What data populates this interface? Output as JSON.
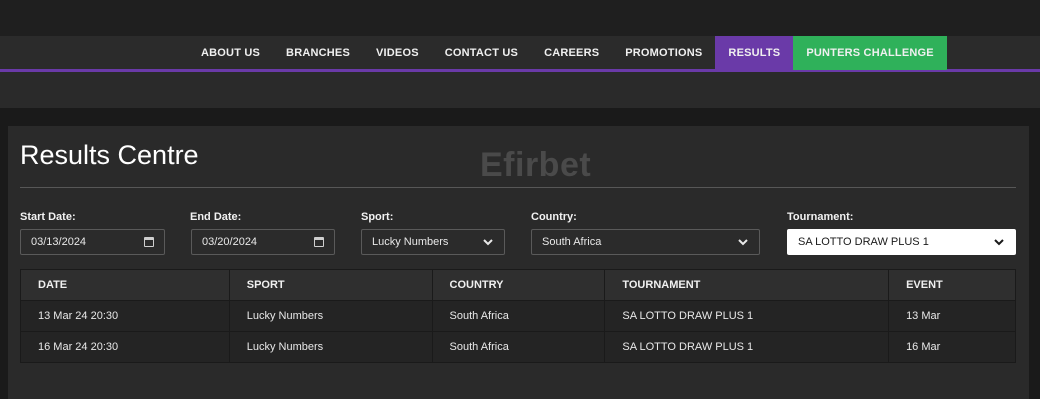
{
  "nav": {
    "items": [
      {
        "label": "ABOUT US"
      },
      {
        "label": "BRANCHES"
      },
      {
        "label": "VIDEOS"
      },
      {
        "label": "CONTACT US"
      },
      {
        "label": "CAREERS"
      },
      {
        "label": "PROMOTIONS"
      },
      {
        "label": "RESULTS",
        "active": true
      },
      {
        "label": "PUNTERS CHALLENGE",
        "highlight": true
      }
    ]
  },
  "colors": {
    "active_tab": "#6a3aa8",
    "highlight_tab": "#2fb15a",
    "event_link": "#f0a040"
  },
  "page": {
    "title": "Results Centre",
    "watermark": "Efirbet"
  },
  "filters": {
    "start_date": {
      "label": "Start Date:",
      "value": "03/13/2024",
      "icon": "calendar-icon"
    },
    "end_date": {
      "label": "End Date:",
      "value": "03/20/2024",
      "icon": "calendar-icon"
    },
    "sport": {
      "label": "Sport:",
      "value": "Lucky Numbers"
    },
    "country": {
      "label": "Country:",
      "value": "South Africa"
    },
    "tournament": {
      "label": "Tournament:",
      "value": "SA LOTTO DRAW PLUS 1"
    }
  },
  "table": {
    "headers": [
      "DATE",
      "SPORT",
      "COUNTRY",
      "TOURNAMENT",
      "EVENT"
    ],
    "rows": [
      [
        "13 Mar 24 20:30",
        "Lucky Numbers",
        "South Africa",
        "SA LOTTO DRAW PLUS 1",
        "13 Mar"
      ],
      [
        "16 Mar 24 20:30",
        "Lucky Numbers",
        "South Africa",
        "SA LOTTO DRAW PLUS 1",
        "16 Mar"
      ]
    ]
  }
}
